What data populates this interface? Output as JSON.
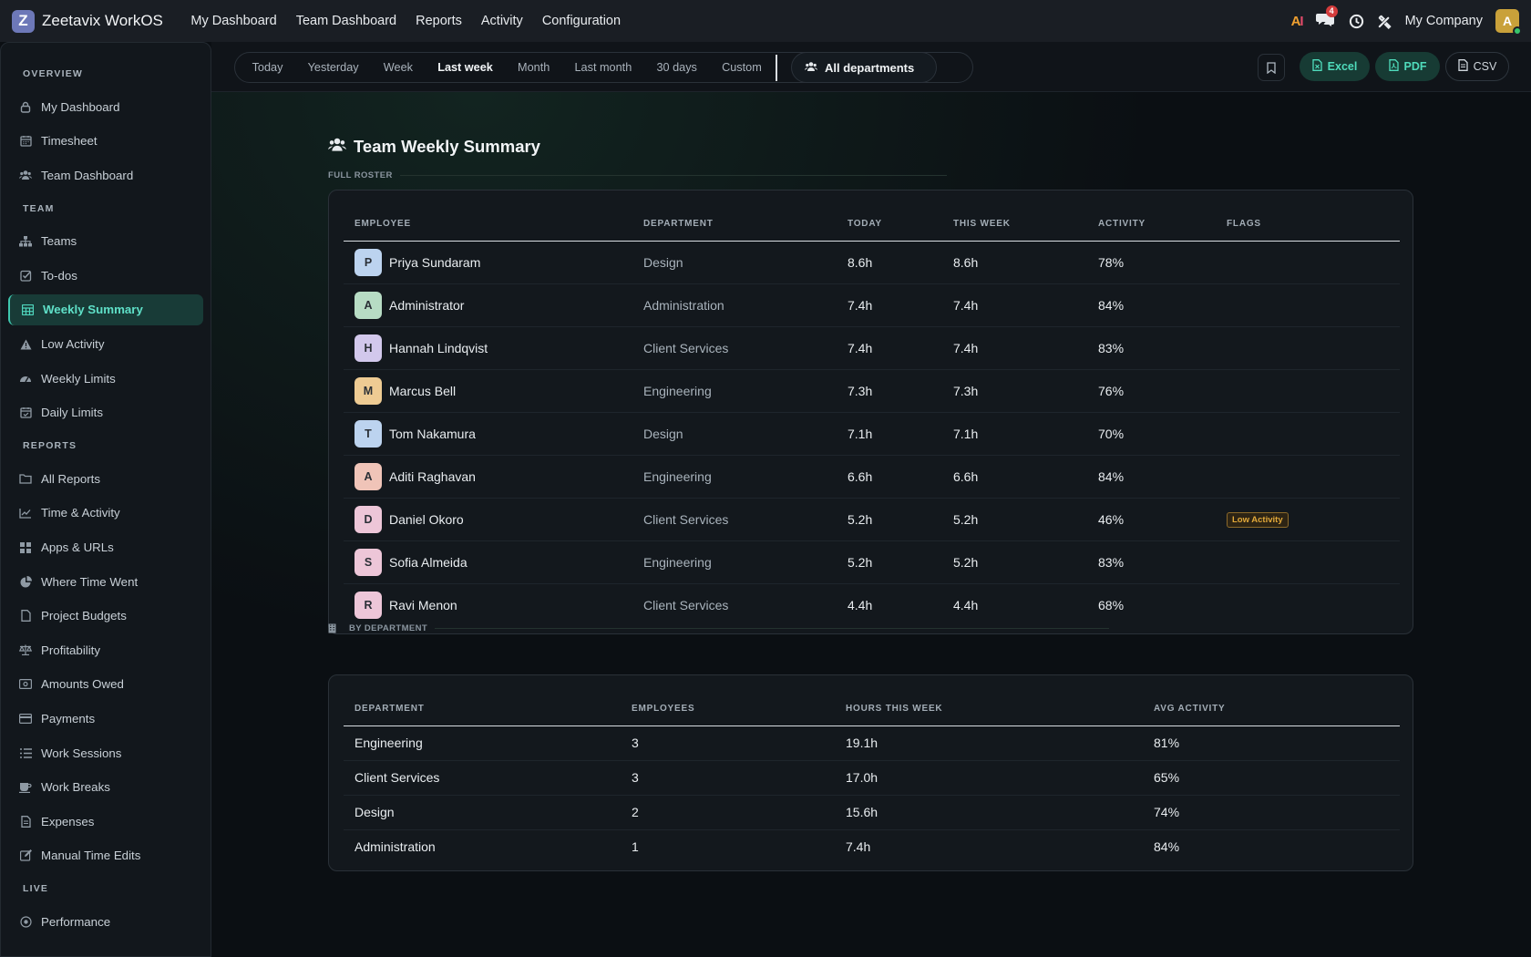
{
  "app": {
    "brand": "Zeetavix WorkOS",
    "logo_letter": "Z",
    "nav": [
      "My Dashboard",
      "Team Dashboard",
      "Reports",
      "Activity",
      "Configuration"
    ],
    "ai_label": "AI",
    "chat_badge": "4",
    "company": "My Company",
    "user_initial": "A"
  },
  "sidebar": {
    "sections": [
      {
        "title": "OVERVIEW",
        "items": [
          {
            "label": "My Dashboard",
            "icon": "lock-icon"
          },
          {
            "label": "Timesheet",
            "icon": "calendar-icon"
          },
          {
            "label": "Team Dashboard",
            "icon": "users-icon"
          }
        ]
      },
      {
        "title": "TEAM",
        "items": [
          {
            "label": "Teams",
            "icon": "sitemap-icon"
          },
          {
            "label": "To-dos",
            "icon": "checkbox-icon"
          },
          {
            "label": "Weekly Summary",
            "icon": "table-icon",
            "active": true
          },
          {
            "label": "Low Activity",
            "icon": "warning-icon"
          },
          {
            "label": "Weekly Limits",
            "icon": "gauge-icon"
          },
          {
            "label": "Daily Limits",
            "icon": "calendar-check-icon"
          }
        ]
      },
      {
        "title": "REPORTS",
        "items": [
          {
            "label": "All Reports",
            "icon": "folder-icon"
          },
          {
            "label": "Time & Activity",
            "icon": "line-chart-icon"
          },
          {
            "label": "Apps & URLs",
            "icon": "grid-icon"
          },
          {
            "label": "Where Time Went",
            "icon": "pie-chart-icon"
          },
          {
            "label": "Project Budgets",
            "icon": "file-icon"
          },
          {
            "label": "Profitability",
            "icon": "scale-icon"
          },
          {
            "label": "Amounts Owed",
            "icon": "money-icon"
          },
          {
            "label": "Payments",
            "icon": "credit-card-icon"
          },
          {
            "label": "Work Sessions",
            "icon": "list-icon"
          },
          {
            "label": "Work Breaks",
            "icon": "coffee-icon"
          },
          {
            "label": "Expenses",
            "icon": "receipt-icon"
          },
          {
            "label": "Manual Time Edits",
            "icon": "edit-icon"
          }
        ]
      },
      {
        "title": "LIVE",
        "items": [
          {
            "label": "Performance",
            "icon": "target-icon"
          }
        ]
      }
    ]
  },
  "filters": {
    "ranges": [
      "Today",
      "Yesterday",
      "Week",
      "Last week",
      "Month",
      "Last month",
      "30 days",
      "Custom"
    ],
    "active_range": "Last week",
    "department": "All departments",
    "export_excel": "Excel",
    "export_pdf": "PDF",
    "export_csv": "CSV"
  },
  "page": {
    "title": "Team Weekly Summary",
    "roster_label": "FULL ROSTER",
    "dept_label": "BY DEPARTMENT"
  },
  "roster": {
    "columns": [
      "EMPLOYEE",
      "DEPARTMENT",
      "TODAY",
      "THIS WEEK",
      "ACTIVITY",
      "FLAGS"
    ],
    "rows": [
      {
        "initial": "P",
        "color": "#bcd3ef",
        "name": "Priya Sundaram",
        "dept": "Design",
        "today": "8.6h",
        "week": "8.6h",
        "activity": "78%",
        "flag": ""
      },
      {
        "initial": "A",
        "color": "#b7dcc4",
        "name": "Administrator",
        "dept": "Administration",
        "today": "7.4h",
        "week": "7.4h",
        "activity": "84%",
        "flag": ""
      },
      {
        "initial": "H",
        "color": "#d2c8ec",
        "name": "Hannah Lindqvist",
        "dept": "Client Services",
        "today": "7.4h",
        "week": "7.4h",
        "activity": "83%",
        "flag": ""
      },
      {
        "initial": "M",
        "color": "#eecb93",
        "name": "Marcus Bell",
        "dept": "Engineering",
        "today": "7.3h",
        "week": "7.3h",
        "activity": "76%",
        "flag": ""
      },
      {
        "initial": "T",
        "color": "#bcd3ef",
        "name": "Tom Nakamura",
        "dept": "Design",
        "today": "7.1h",
        "week": "7.1h",
        "activity": "70%",
        "flag": ""
      },
      {
        "initial": "A",
        "color": "#f0c4b8",
        "name": "Aditi Raghavan",
        "dept": "Engineering",
        "today": "6.6h",
        "week": "6.6h",
        "activity": "84%",
        "flag": ""
      },
      {
        "initial": "D",
        "color": "#edc6d8",
        "name": "Daniel Okoro",
        "dept": "Client Services",
        "today": "5.2h",
        "week": "5.2h",
        "activity": "46%",
        "flag": "Low Activity"
      },
      {
        "initial": "S",
        "color": "#edc6d8",
        "name": "Sofia Almeida",
        "dept": "Engineering",
        "today": "5.2h",
        "week": "5.2h",
        "activity": "83%",
        "flag": ""
      },
      {
        "initial": "R",
        "color": "#edc6d8",
        "name": "Ravi Menon",
        "dept": "Client Services",
        "today": "4.4h",
        "week": "4.4h",
        "activity": "68%",
        "flag": ""
      }
    ]
  },
  "departments": {
    "columns": [
      "DEPARTMENT",
      "EMPLOYEES",
      "HOURS THIS WEEK",
      "AVG ACTIVITY"
    ],
    "rows": [
      {
        "dept": "Engineering",
        "employees": "3",
        "hours": "19.1h",
        "avg": "81%"
      },
      {
        "dept": "Client Services",
        "employees": "3",
        "hours": "17.0h",
        "avg": "65%"
      },
      {
        "dept": "Design",
        "employees": "2",
        "hours": "15.6h",
        "avg": "74%"
      },
      {
        "dept": "Administration",
        "employees": "1",
        "hours": "7.4h",
        "avg": "84%"
      }
    ]
  }
}
